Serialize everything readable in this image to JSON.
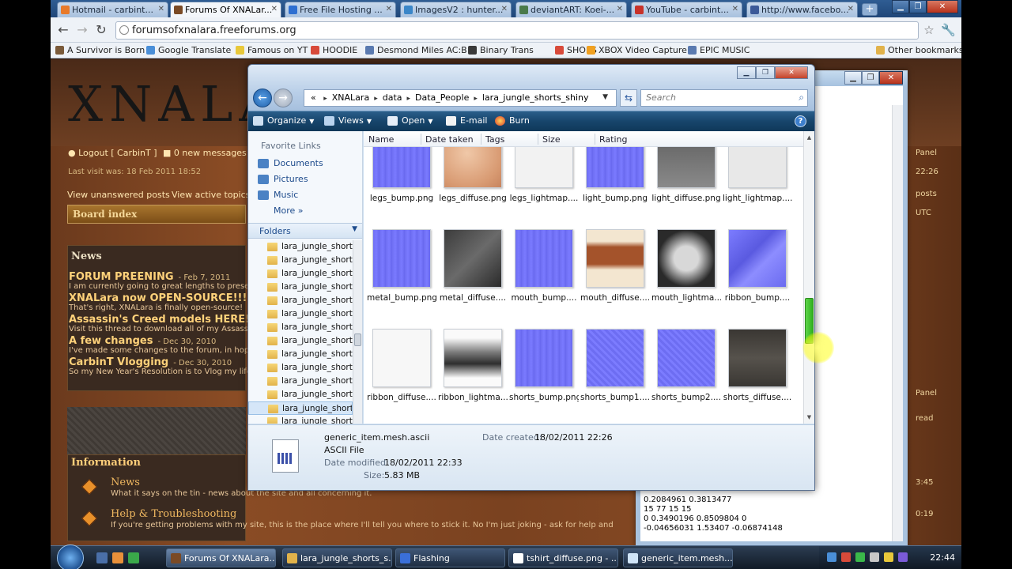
{
  "browser": {
    "tabs": [
      {
        "label": "Hotmail - carbint...",
        "color": "#e87a2a"
      },
      {
        "label": "Forums Of XNALar...",
        "color": "#7a4a25",
        "active": true
      },
      {
        "label": "Free File Hosting ...",
        "color": "#2e6fd1"
      },
      {
        "label": "ImagesV2 : hunter...",
        "color": "#3a86c8"
      },
      {
        "label": "deviantART: Koei-...",
        "color": "#4a7a4a"
      },
      {
        "label": "YouTube - carbint...",
        "color": "#c8322a"
      },
      {
        "label": "http://www.facebo...",
        "color": "#3b5998"
      }
    ],
    "url": "forumsofxnalara.freeforums.org",
    "bookmarks": [
      "A Survivor is Born",
      "Google Translate",
      "Famous on YT",
      "HOODIE",
      "Desmond Miles AC:B",
      "Binary Trans",
      "SHOES",
      "XBOX Video Capture",
      "EPIC MUSIC"
    ],
    "other_bookmarks": "Other bookmarks"
  },
  "forum": {
    "logo": "XNALARA",
    "logout": "Logout [ CarbinT ]",
    "new_messages": "0 new messages",
    "last_visit": "Last visit was: 18 Feb 2011 18:52",
    "view_unanswered": "View unanswered posts",
    "view_active": "View active topics",
    "board_index": "Board index",
    "news_title": "News",
    "news": [
      {
        "title": "FORUM PREENING",
        "date": "- Feb 7, 2011",
        "line": "I am currently going to great lengths to present"
      },
      {
        "title": "XNALara now OPEN-SOURCE!!!",
        "date": "",
        "line": "That's right, XNALara is finally open-source!"
      },
      {
        "title": "Assassin's Creed models HERE!!",
        "date": "",
        "line": "Visit this thread to download all of my Assassin"
      },
      {
        "title": "A few changes",
        "date": "- Dec 30, 2010",
        "line": "I've made some changes to the forum, in hope"
      },
      {
        "title": "CarbinT Vlogging",
        "date": "- Dec 30, 2010",
        "line": "So my New Year's Resolution is to Vlog my life"
      }
    ],
    "right_panel": "Panel",
    "right_time": "22:26",
    "right_posts": "posts",
    "right_utc": "UTC",
    "right_panel2": "Panel",
    "right_read": "read",
    "info_title": "Information",
    "info_rows": [
      {
        "title": "News",
        "desc": "What it says on the tin - news about the site and all concerning it.",
        "time": "3:45"
      },
      {
        "title": "Help & Troubleshooting",
        "desc": "If you're getting problems with my site, this is the place where I'll tell you where to stick it. No I'm just joking - ask for help and",
        "time": "0:19"
      }
    ]
  },
  "notepad": {
    "lines": [
      "0.2084961 0.3813477",
      "15 77 15 15",
      "0 0.3490196 0.8509804 0",
      "-0.04656031 1.53407 -0.06874148"
    ]
  },
  "explorer": {
    "path": [
      "XNALara",
      "data",
      "Data_People",
      "lara_jungle_shorts_shiny"
    ],
    "path_prefix": "«",
    "search_placeholder": "Search",
    "commands": {
      "organize": "Organize",
      "views": "Views",
      "open": "Open",
      "email": "E-mail",
      "burn": "Burn"
    },
    "favorite_links_title": "Favorite Links",
    "favorite_links": [
      "Documents",
      "Pictures",
      "Music"
    ],
    "more": "More",
    "folders_title": "Folders",
    "tree": [
      "lara_jungle_shorts_",
      "lara_jungle_shorts_",
      "lara_jungle_shorts_",
      "lara_jungle_shorts_",
      "lara_jungle_shorts_",
      "lara_jungle_shorts_",
      "lara_jungle_shorts_",
      "lara_jungle_shorts_",
      "lara_jungle_shorts_",
      "lara_jungle_shorts_",
      "lara_jungle_shorts_",
      "lara_jungle_shorts_",
      "lara_jungle_shorts_",
      "lara_jungle_shorts_"
    ],
    "tree_selected_index": 12,
    "columns": [
      "Name",
      "Date taken",
      "Tags",
      "Size",
      "Rating"
    ],
    "files": [
      {
        "name": "legs_bump.png",
        "tex": "t-bump"
      },
      {
        "name": "legs_diffuse.png",
        "tex": "t-skin"
      },
      {
        "name": "legs_lightmap....",
        "tex": "t-light"
      },
      {
        "name": "light_bump.png",
        "tex": "t-bump"
      },
      {
        "name": "light_diffuse.png",
        "tex": "t-gray"
      },
      {
        "name": "light_lightmap....",
        "tex": "t-lightmap2"
      },
      {
        "name": "metal_bump.png",
        "tex": "t-bump"
      },
      {
        "name": "metal_diffuse....",
        "tex": "t-metal"
      },
      {
        "name": "mouth_bump....",
        "tex": "t-bump"
      },
      {
        "name": "mouth_diffuse....",
        "tex": "t-mouth"
      },
      {
        "name": "mouth_lightma....",
        "tex": "t-mouthl"
      },
      {
        "name": "ribbon_bump....",
        "tex": "t-ribbon"
      },
      {
        "name": "ribbon_diffuse....",
        "tex": "t-ribdiff"
      },
      {
        "name": "ribbon_lightma....",
        "tex": "t-riblight"
      },
      {
        "name": "shorts_bump.png",
        "tex": "t-bump"
      },
      {
        "name": "shorts_bump1....",
        "tex": "t-shorts"
      },
      {
        "name": "shorts_bump2....",
        "tex": "t-shorts"
      },
      {
        "name": "shorts_diffuse....",
        "tex": "t-shortsdiff"
      }
    ],
    "details": {
      "filename": "generic_item.mesh.ascii",
      "type": "ASCII File",
      "date_created_label": "Date created:",
      "date_created": "18/02/2011 22:26",
      "date_modified_label": "Date modified:",
      "date_modified": "18/02/2011 22:33",
      "size_label": "Size:",
      "size": "5.83 MB"
    }
  },
  "taskbar": {
    "tasks": [
      {
        "label": "Forums Of XNALara...",
        "color": "#7a4a25",
        "active": true
      },
      {
        "label": "lara_jungle_shorts_s...",
        "color": "#e1b24a"
      },
      {
        "label": "Flashing",
        "color": "#3a6fd8"
      },
      {
        "label": "tshirt_diffuse.png - ...",
        "color": "#ffffff"
      },
      {
        "label": "generic_item.mesh....",
        "color": "#d0e4f7"
      }
    ],
    "clock": "22:44"
  }
}
